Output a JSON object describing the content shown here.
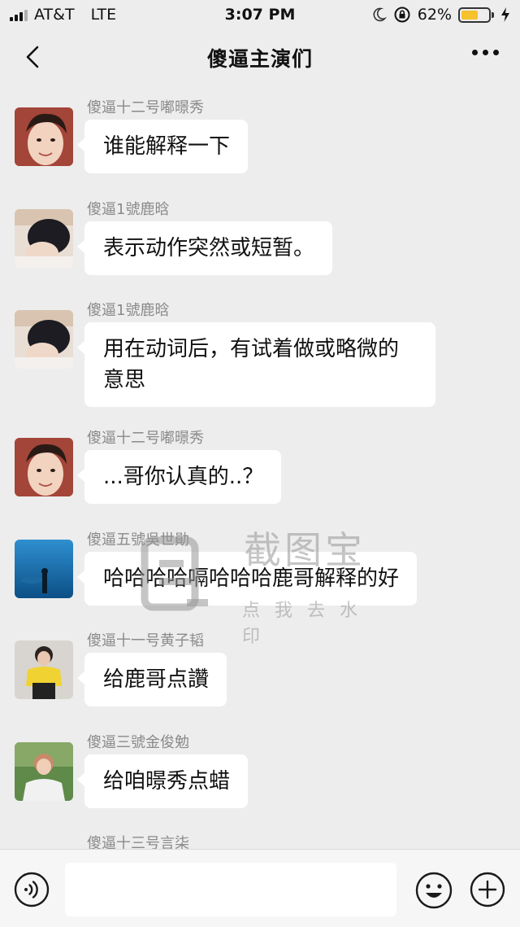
{
  "status_bar": {
    "carrier": "AT&T",
    "network": "LTE",
    "time": "3:07 PM",
    "battery_percent": "62%",
    "battery_level": 0.62,
    "icons": [
      "moon-icon",
      "rotation-lock-icon",
      "charging-icon"
    ]
  },
  "nav": {
    "title": "傻逼主演们",
    "back_icon": "chevron-left-icon",
    "more_icon": "ellipsis-icon"
  },
  "messages": [
    {
      "sender": "傻逼十二号嘟暻秀",
      "text": "谁能解释一下",
      "avatar": "avatar-portrait-smiling"
    },
    {
      "sender": "傻逼1號鹿晗",
      "text": "表示动作突然或短暂。",
      "avatar": "avatar-dark-hair"
    },
    {
      "sender": "傻逼1號鹿晗",
      "text": "用在动词后，有试着做或略微的意思",
      "avatar": "avatar-dark-hair"
    },
    {
      "sender": "傻逼十二号嘟暻秀",
      "text": "...哥你认真的..？",
      "avatar": "avatar-portrait-smiling"
    },
    {
      "sender": "傻逼五號吳世勛",
      "text": "哈哈哈哈嗝哈哈哈鹿哥解释的好",
      "avatar": "avatar-aquarium-blue"
    },
    {
      "sender": "傻逼十一号黄子韬",
      "text": "给鹿哥点讚",
      "avatar": "avatar-yellow-jacket"
    },
    {
      "sender": "傻逼三號金俊勉",
      "text": "给咱暻秀点蜡",
      "avatar": "avatar-green-outdoor"
    },
    {
      "sender": "傻逼十三号言柒",
      "text": "",
      "avatar": "avatar-partial"
    }
  ],
  "watermark": {
    "line1": "截图宝",
    "line2": "点我去水印"
  },
  "input_bar": {
    "placeholder": "",
    "voice_icon": "voice-icon",
    "emoji_icon": "emoji-icon",
    "plus_icon": "plus-icon"
  }
}
